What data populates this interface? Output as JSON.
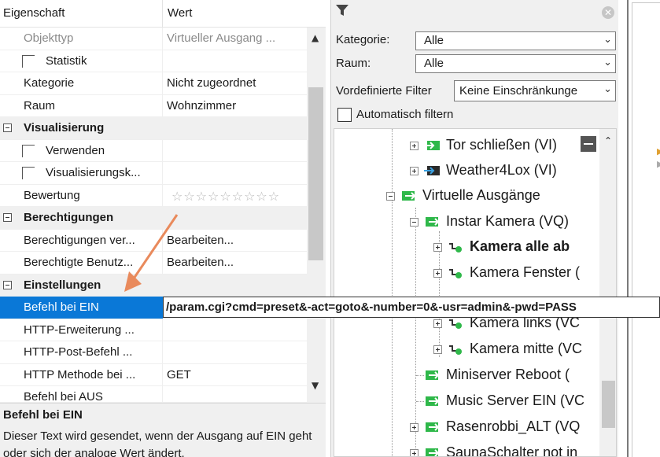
{
  "props": {
    "header": {
      "col1": "Eigenschaft",
      "col2": "Wert"
    },
    "rows": [
      {
        "name": "Objekttyp",
        "value": "Virtueller Ausgang ..."
      },
      {
        "name": "Statistik",
        "value": ""
      },
      {
        "name": "Kategorie",
        "value": "Nicht zugeordnet"
      },
      {
        "name": "Raum",
        "value": "Wohnzimmer"
      },
      {
        "name": "Visualisierung",
        "value": ""
      },
      {
        "name": "Verwenden",
        "value": ""
      },
      {
        "name": "Visualisierungsk...",
        "value": ""
      },
      {
        "name": "Bewertung",
        "value": "☆☆☆☆☆☆☆☆☆"
      },
      {
        "name": "Berechtigungen",
        "value": ""
      },
      {
        "name": "Berechtigungen ver...",
        "value": "Bearbeiten..."
      },
      {
        "name": "Berechtigte Benutz...",
        "value": "Bearbeiten..."
      },
      {
        "name": "Einstellungen",
        "value": ""
      },
      {
        "name": "Befehl bei EIN",
        "value": ""
      },
      {
        "name": "HTTP-Erweiterung ...",
        "value": ""
      },
      {
        "name": "HTTP-Post-Befehl ...",
        "value": ""
      },
      {
        "name": "HTTP Methode bei ...",
        "value": "GET"
      },
      {
        "name": "Befehl bei AUS",
        "value": ""
      }
    ]
  },
  "description": {
    "title": "Befehl bei EIN",
    "text": "Dieser Text wird gesendet, wenn der Ausgang auf EIN geht oder sich der analoge Wert ändert."
  },
  "value_popup": "/param.cgi?cmd=preset&-act=goto&-number=0&-usr=admin&-pwd=PASS",
  "filter": {
    "kategorie_label": "Kategorie:",
    "kategorie_value": "Alle",
    "raum_label": "Raum:",
    "raum_value": "Alle",
    "vordef_label": "Vordefinierte Filter",
    "vordef_value": "Keine Einschränkunge",
    "auto_label": "Automatisch filtern"
  },
  "tree": [
    {
      "label": "Tor schließen (VI)",
      "icon": "green-input-icon"
    },
    {
      "label": "Weather4Lox (VI)",
      "icon": "dark-input-icon"
    },
    {
      "label": "Virtuelle Ausgänge",
      "icon": "green-output-icon"
    },
    {
      "label": "Instar Kamera (VQ)",
      "icon": "green-output-icon"
    },
    {
      "label": "Kamera alle ab",
      "icon": "command-icon"
    },
    {
      "label": "Kamera Fenster (",
      "icon": "command-icon"
    },
    {
      "label": "Kamera links (VC",
      "icon": "command-icon"
    },
    {
      "label": "Kamera mitte (VC",
      "icon": "command-icon"
    },
    {
      "label": "Miniserver Reboot (",
      "icon": "green-output-icon"
    },
    {
      "label": "Music Server EIN (VC",
      "icon": "green-output-icon"
    },
    {
      "label": "Rasenrobbi_ALT (VQ",
      "icon": "green-output-icon"
    },
    {
      "label": "SaunaSchalter not in",
      "icon": "green-output-icon"
    }
  ],
  "colors": {
    "selection": "#0a78d7",
    "group_bg": "#f0f0f0",
    "green_icon": "#2fb84a",
    "arrow": "#e98a5c"
  }
}
